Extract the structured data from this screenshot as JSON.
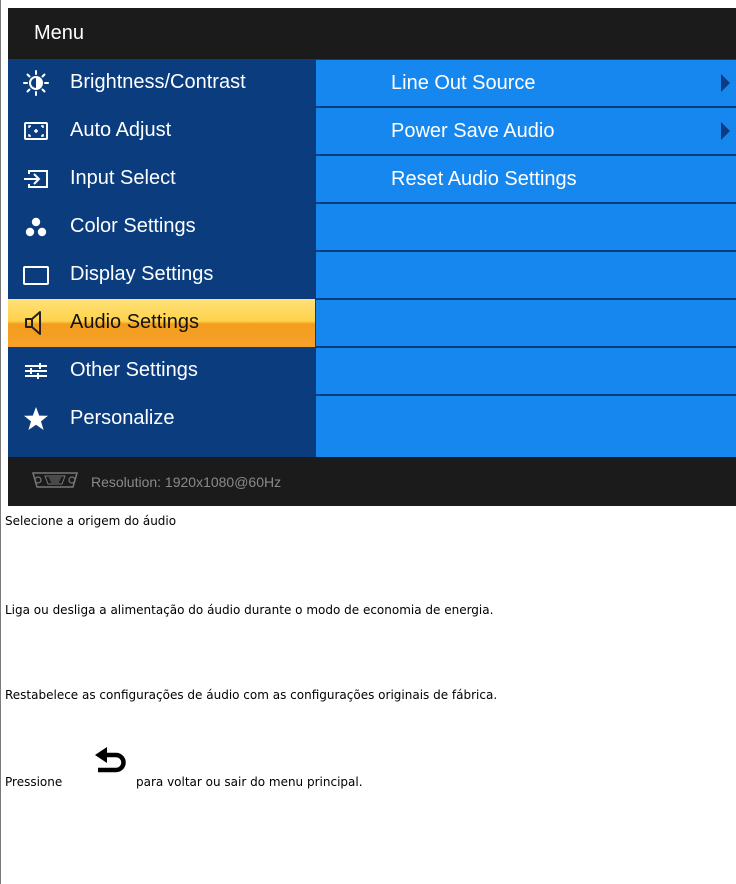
{
  "osd": {
    "title": "Menu",
    "menu_items": [
      {
        "label": "Brightness/Contrast",
        "icon": "brightness-icon",
        "active": false
      },
      {
        "label": "Auto Adjust",
        "icon": "auto-adjust-icon",
        "active": false
      },
      {
        "label": "Input Select",
        "icon": "input-select-icon",
        "active": false
      },
      {
        "label": "Color Settings",
        "icon": "color-settings-icon",
        "active": false
      },
      {
        "label": "Display Settings",
        "icon": "display-settings-icon",
        "active": false
      },
      {
        "label": "Audio Settings",
        "icon": "speaker-icon",
        "active": true
      },
      {
        "label": "Other Settings",
        "icon": "sliders-icon",
        "active": false
      },
      {
        "label": "Personalize",
        "icon": "star-icon",
        "active": false
      }
    ],
    "submenu": [
      {
        "label": "Line Out Source",
        "has_arrow": true
      },
      {
        "label": "Power Save Audio",
        "has_arrow": true
      },
      {
        "label": "Reset Audio Settings",
        "has_arrow": false
      },
      {
        "label": "",
        "has_arrow": false
      },
      {
        "label": "",
        "has_arrow": false
      },
      {
        "label": "",
        "has_arrow": false
      },
      {
        "label": "",
        "has_arrow": false
      },
      {
        "label": "",
        "has_arrow": false
      }
    ],
    "footer": {
      "icon": "vga-connector-icon",
      "resolution": "Resolution: 1920x1080@60Hz"
    }
  },
  "descriptions": [
    "Selecione a origem do áudio",
    "Liga ou desliga a alimentação do áudio durante o modo de economia de energia.",
    "Restabelece as configurações de áudio com as configurações originais de fábrica."
  ],
  "back_note": {
    "before": "Pressione",
    "icon": "back-arrow-icon",
    "after": "para voltar ou sair do menu principal."
  },
  "colors": {
    "panel": "#0a3c7e",
    "submenu_row": "#1587ee",
    "highlight": "#f6a12a",
    "frame": "#1b1b1b"
  }
}
